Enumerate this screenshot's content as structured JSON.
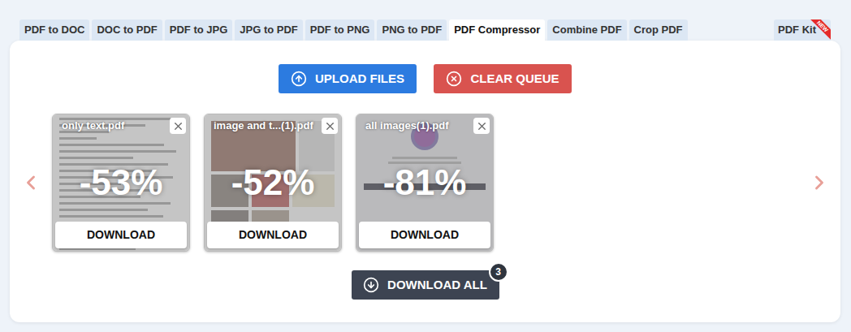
{
  "tabs": [
    {
      "label": "PDF to DOC",
      "selected": false
    },
    {
      "label": "DOC to PDF",
      "selected": false
    },
    {
      "label": "PDF to JPG",
      "selected": false
    },
    {
      "label": "JPG to PDF",
      "selected": false
    },
    {
      "label": "PDF to PNG",
      "selected": false
    },
    {
      "label": "PNG to PDF",
      "selected": false
    },
    {
      "label": "PDF Compressor",
      "selected": true
    },
    {
      "label": "Combine PDF",
      "selected": false
    },
    {
      "label": "Crop PDF",
      "selected": false
    }
  ],
  "kit_tab": {
    "label": "PDF Kit",
    "badge": "NEW",
    "selected": false
  },
  "actions": {
    "upload": "UPLOAD FILES",
    "clear": "CLEAR QUEUE"
  },
  "files": [
    {
      "name": "only text.pdf",
      "reduction": "-53%",
      "download": "DOWNLOAD",
      "kind": "text"
    },
    {
      "name": "image and t...(1).pdf",
      "reduction": "-52%",
      "download": "DOWNLOAD",
      "kind": "photo"
    },
    {
      "name": "all images(1).pdf",
      "reduction": "-81%",
      "download": "DOWNLOAD",
      "kind": "image"
    }
  ],
  "download_all": {
    "label": "DOWNLOAD ALL",
    "count": "3"
  }
}
